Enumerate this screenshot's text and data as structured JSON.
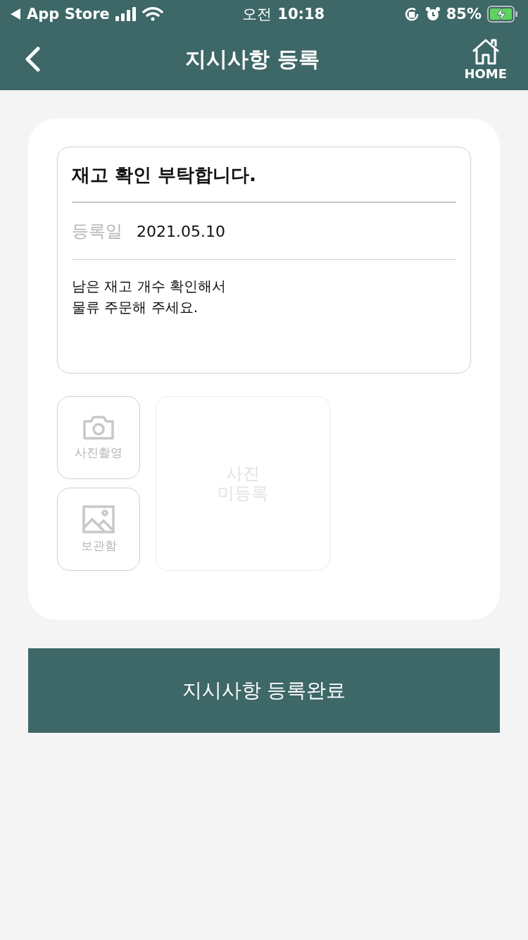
{
  "status_bar": {
    "back_app": "App Store",
    "time_prefix": "오전",
    "time": "10:18",
    "battery": "85%"
  },
  "nav": {
    "title": "지시사항 등록",
    "home_label": "HOME"
  },
  "memo": {
    "title": "재고 확인 부탁합니다.",
    "date_label": "등록일",
    "date": "2021.05.10",
    "body": "남은 재고 개수 확인해서\n물류 주문해 주세요."
  },
  "photo_buttons": [
    {
      "kind": "camera",
      "label": "사진촬영"
    },
    {
      "kind": "gallery",
      "label": "보관함"
    }
  ],
  "photo_placeholder": "사진\n미등록",
  "submit": "지시사항 등록완료"
}
